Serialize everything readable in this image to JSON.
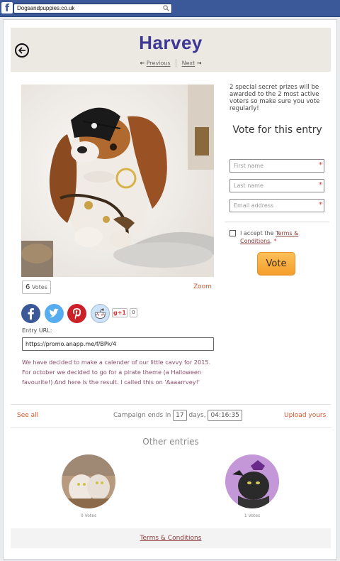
{
  "browser": {
    "facebook_logo": "f",
    "address": "Dogsandpuppies.co.uk",
    "icon": "search-icon"
  },
  "entry": {
    "name": "Harvey",
    "previous_label": "Previous",
    "next_label": "Next",
    "votes_count": "6",
    "votes_word": "Votes",
    "zoom_label": "Zoom",
    "entry_url_label": "Entry URL:",
    "entry_url": "https://promo.anapp.me/f/BPk/4",
    "description": "We have decided to make a calender of our little cavvy for 2015. For october we decided to go for a pirate theme (a Halloween favourite!) And here is the result. I called this on 'Aaaarrvey!'"
  },
  "social": {
    "icons": [
      "facebook-icon",
      "twitter-icon",
      "pinterest-icon",
      "reddit-icon"
    ],
    "gplus_label": "g+1",
    "gplus_count": "0",
    "colors": {
      "facebook": "#3b5998",
      "twitter": "#55acee",
      "pinterest": "#cb2027",
      "reddit": "#cee3f8"
    }
  },
  "vote_panel": {
    "prize_text": "2 special secret prizes will be awarded to the 2 most active voters so make sure you vote regularly!",
    "title": "Vote for this entry",
    "first_name_placeholder": "First name",
    "last_name_placeholder": "Last name",
    "email_placeholder": "Email address",
    "required_mark": "*",
    "accept_prefix": "I accept the",
    "accept_link": "Terms & Conditions",
    "accept_suffix": ".",
    "vote_button": "Vote"
  },
  "campaign": {
    "see_all": "See all",
    "ends_prefix": "Campaign ends in",
    "days": "17",
    "days_word": "days,",
    "time": "04:16:35",
    "upload": "Upload yours"
  },
  "other_entries": {
    "title": "Other entries",
    "items": [
      {
        "votes": "0 Votes"
      },
      {
        "votes": "1 Votes"
      }
    ]
  },
  "footer": {
    "terms": "Terms & Conditions"
  },
  "colors": {
    "accent": "#d2592f",
    "title": "#3f3796",
    "vote_button": "#f7a93a",
    "fb_bar": "#3b5998"
  }
}
